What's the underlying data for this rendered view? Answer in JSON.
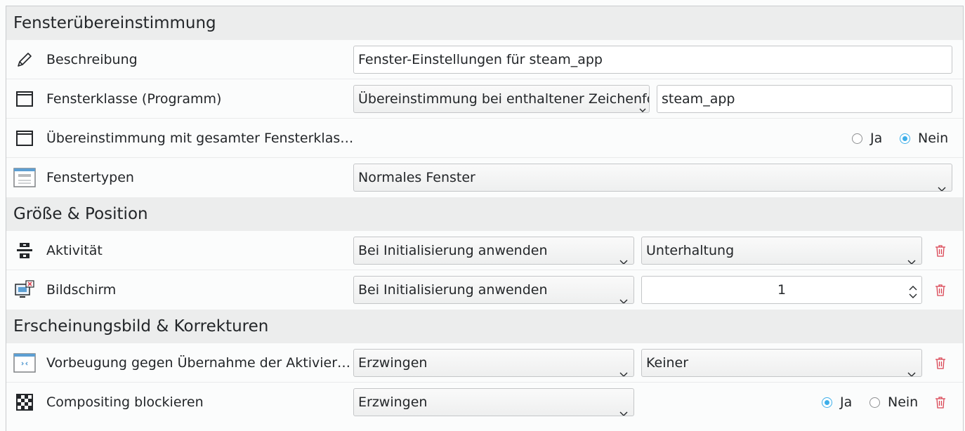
{
  "colors": {
    "accent": "#3daee9",
    "trash": "#da4453"
  },
  "sections": {
    "match": "Fensterübereinstimmung",
    "size": "Größe & Position",
    "appearance": "Erscheinungsbild & Korrekturen"
  },
  "rows": {
    "description": {
      "label": "Beschreibung",
      "value": "Fenster-Einstellungen für steam_app",
      "icon": "pencil-icon"
    },
    "window_class": {
      "label": "Fensterklasse (Programm)",
      "match_type": "Übereinstimmung bei enthaltener Zeichenfolge",
      "value": "steam_app",
      "icon": "window-icon"
    },
    "whole_class": {
      "label": "Übereinstimmung mit gesamter Fensterklas…",
      "yes": "Ja",
      "no": "Nein",
      "selected": "Nein",
      "icon": "window-icon"
    },
    "window_types": {
      "label": "Fenstertypen",
      "value": "Normales Fenster",
      "icon": "window-types-icon"
    },
    "activity": {
      "label": "Aktivität",
      "policy": "Bei Initialisierung anwenden",
      "value": "Unterhaltung",
      "icon": "activity-icon"
    },
    "screen": {
      "label": "Bildschirm",
      "policy": "Bei Initialisierung anwenden",
      "value": "1",
      "icon": "screen-icon"
    },
    "focus_stealing": {
      "label": "Vorbeugung gegen Übernahme der Aktivier…",
      "policy": "Erzwingen",
      "value": "Keiner",
      "icon": "focus-icon"
    },
    "block_compositing": {
      "label": "Compositing blockieren",
      "policy": "Erzwingen",
      "yes": "Ja",
      "no": "Nein",
      "selected": "Ja",
      "icon": "checkerboard-icon"
    }
  }
}
